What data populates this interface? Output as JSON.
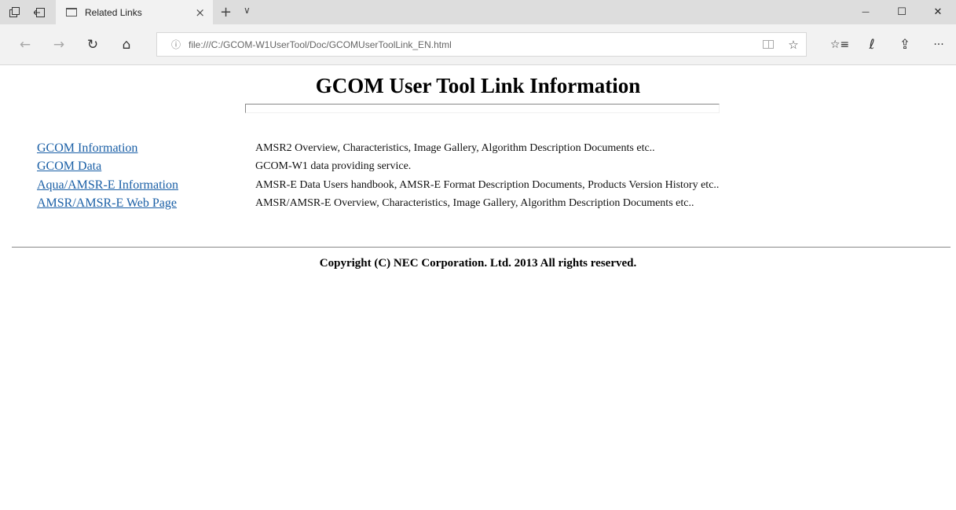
{
  "browser": {
    "tab_title": "Related Links",
    "tab_close": "×",
    "new_tab": "+",
    "tab_list": "∨",
    "address": "file:///C:/GCOM-W1UserTool/Doc/GCOMUserToolLink_EN.html",
    "icons": {
      "back": "←",
      "forward": "→",
      "refresh": "↻",
      "home": "⌂",
      "info": "ⓘ",
      "favorite": "☆",
      "favorites_list": "☆≡",
      "notes": "ℓ",
      "share": "⇪",
      "more": "···",
      "minimize": "—",
      "maximize": "☐",
      "close": "✕"
    }
  },
  "page": {
    "title": "GCOM User Tool Link Information",
    "links": [
      {
        "label": "GCOM Information",
        "description": "AMSR2 Overview, Characteristics, Image Gallery, Algorithm Description Documents etc.."
      },
      {
        "label": "GCOM Data",
        "description": "GCOM-W1 data providing service."
      },
      {
        "label": "Aqua/AMSR-E Information",
        "description": "AMSR-E Data Users handbook, AMSR-E Format Description Documents, Products Version History etc.."
      },
      {
        "label": "AMSR/AMSR-E Web Page",
        "description": "AMSR/AMSR-E Overview, Characteristics, Image Gallery, Algorithm Description Documents etc.."
      }
    ],
    "copyright": "Copyright (C) NEC Corporation. Ltd. 2013 All rights reserved."
  }
}
